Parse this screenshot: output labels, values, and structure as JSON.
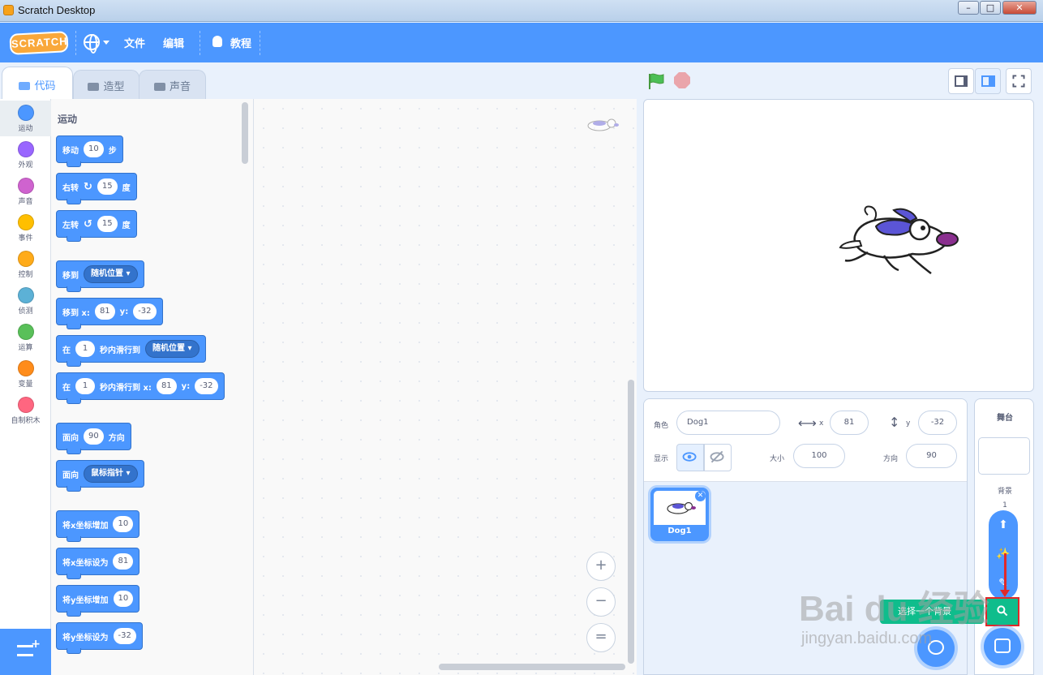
{
  "window": {
    "title": "Scratch Desktop",
    "minimize": "–",
    "maximize": "□",
    "close": "✕"
  },
  "menubar": {
    "logo": "SCRATCH",
    "file": "文件",
    "edit": "编辑",
    "tutorials": "教程"
  },
  "tabs": [
    {
      "label": "代码",
      "icon": "code-icon",
      "active": true
    },
    {
      "label": "造型",
      "icon": "brush-icon",
      "active": false
    },
    {
      "label": "声音",
      "icon": "speaker-icon",
      "active": false
    }
  ],
  "categories": [
    {
      "label": "运动",
      "color": "#4c97ff",
      "selected": true
    },
    {
      "label": "外观",
      "color": "#9966ff"
    },
    {
      "label": "声音",
      "color": "#cf63cf"
    },
    {
      "label": "事件",
      "color": "#ffbf00"
    },
    {
      "label": "控制",
      "color": "#ffab19"
    },
    {
      "label": "侦测",
      "color": "#5cb1d6"
    },
    {
      "label": "运算",
      "color": "#59c059"
    },
    {
      "label": "变量",
      "color": "#ff8c1a"
    },
    {
      "label": "自制积木",
      "color": "#ff6680"
    }
  ],
  "palette": {
    "section_title": "运动",
    "blocks": {
      "move": {
        "a": "移动",
        "n": "10",
        "b": "步"
      },
      "turn_right": {
        "a": "右转",
        "n": "15",
        "b": "度"
      },
      "turn_left": {
        "a": "左转",
        "n": "15",
        "b": "度"
      },
      "goto": {
        "a": "移到",
        "menu": "随机位置"
      },
      "goto_xy": {
        "a": "移到 x:",
        "x": "81",
        "ylab": "y:",
        "y": "-32"
      },
      "glide_to": {
        "a": "在",
        "n": "1",
        "b": "秒内滑行到",
        "menu": "随机位置"
      },
      "glide_xy": {
        "a": "在",
        "n": "1",
        "b": "秒内滑行到 x:",
        "x": "81",
        "ylab": "y:",
        "y": "-32"
      },
      "point_dir": {
        "a": "面向",
        "n": "90",
        "b": "方向"
      },
      "point_towards": {
        "a": "面向",
        "menu": "鼠标指针"
      },
      "change_x": {
        "a": "将x坐标增加",
        "n": "10"
      },
      "set_x": {
        "a": "将x坐标设为",
        "n": "81"
      },
      "change_y": {
        "a": "将y坐标增加",
        "n": "10"
      },
      "set_y": {
        "a": "将y坐标设为",
        "n": "-32"
      }
    }
  },
  "script_area": {
    "zoom_in": "+",
    "zoom_out": "−",
    "reset": "="
  },
  "sprite_info": {
    "sprite_label": "角色",
    "sprite_name": "Dog1",
    "x_label": "x",
    "x": "81",
    "y_label": "y",
    "y": "-32",
    "show_label": "显示",
    "size_label": "大小",
    "size": "100",
    "direction_label": "方向",
    "direction": "90"
  },
  "sprites": [
    {
      "name": "Dog1",
      "selected": true
    }
  ],
  "stage_pane": {
    "title": "舞台",
    "backdrops_label": "背景",
    "backdrop_count": "1"
  },
  "backdrop_menu": {
    "tooltip": "选择一个背景"
  },
  "watermark": {
    "text": "Bai du 经验",
    "url": "jingyan.baidu.com"
  },
  "colors": {
    "menubar": "#4c97ff",
    "motion": "#4c97ff",
    "highlight": "#e02929",
    "search": "#0fbd8c"
  }
}
